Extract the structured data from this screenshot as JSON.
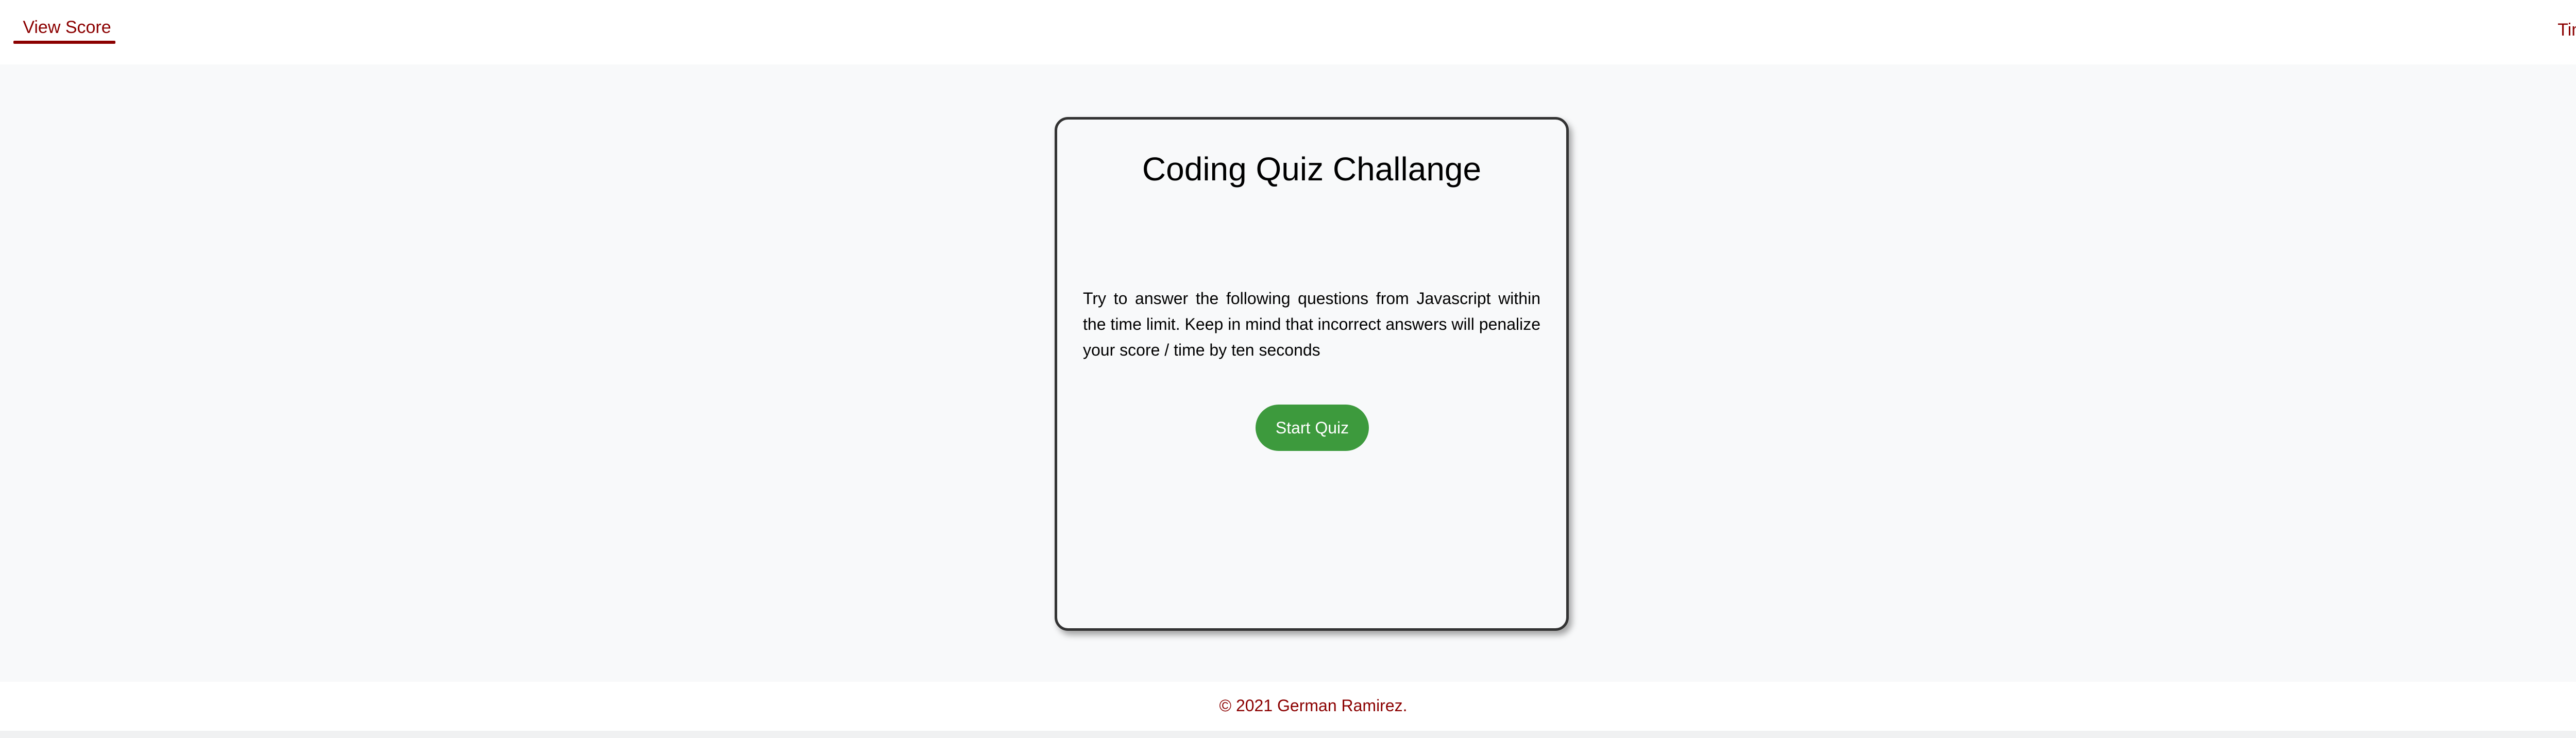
{
  "header": {
    "view_score_label": "View Score",
    "time_label": "Time:",
    "time_value": ""
  },
  "card": {
    "title": "Coding Quiz Challange",
    "description": "Try to answer the following questions from Javascript within the time limit. Keep in mind that incorrect answers will penalize your score / time by ten seconds",
    "start_button_label": "Start Quiz"
  },
  "footer": {
    "copyright": "© 2021 German Ramirez."
  },
  "colors": {
    "accent": "#8b0000",
    "button": "#3d9a3d",
    "background": "#f8f9fa",
    "card_border": "#333333"
  }
}
